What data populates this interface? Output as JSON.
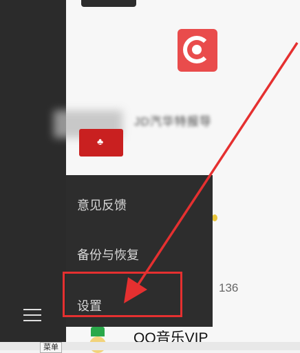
{
  "list": {
    "blurred_item_name": "JD汽华特报导",
    "count_badge": "136",
    "qq_music_title": "QQ音乐VIP"
  },
  "menu": {
    "items": [
      "意见反馈",
      "备份与恢复",
      "设置"
    ]
  },
  "tooltip": {
    "text": "菜单"
  },
  "colors": {
    "rail": "#2b2b2b",
    "menu_bg": "#2d2d2d",
    "highlight": "#e53030",
    "arrow": "#e53030"
  },
  "icons": [
    "hamburger-menu-icon",
    "app-logo-icon",
    "qq-music-icon"
  ]
}
